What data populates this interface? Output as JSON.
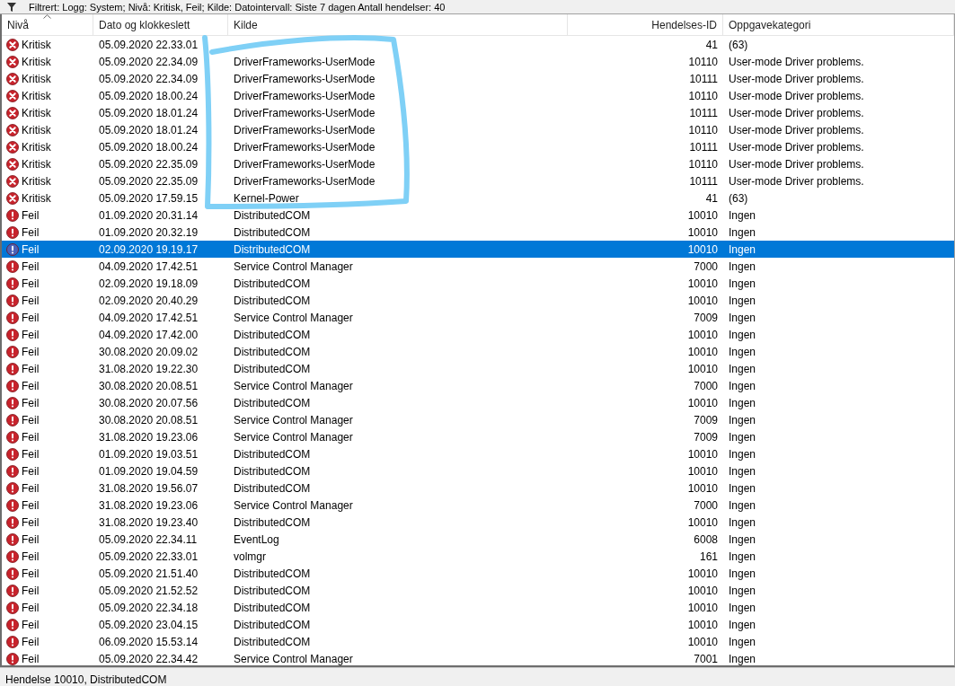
{
  "filter_bar": {
    "text": "Filtrert: Logg: System; Nivå: Kritisk, Feil; Kilde: Datointervall: Siste 7 dagen Antall hendelser: 40"
  },
  "table": {
    "columns": [
      "Nivå",
      "Dato og klokkeslett",
      "Kilde",
      "Hendelses-ID",
      "Oppgavekategori"
    ],
    "rows": [
      {
        "kind": "critical",
        "level": "Kritisk",
        "date": "05.09.2020 22.33.01",
        "id": "41",
        "category": "(63)",
        "selected": false
      },
      {
        "kind": "critical",
        "level": "Kritisk",
        "date": "05.09.2020 22.34.09",
        "source": "DriverFrameworks-UserMode",
        "id": "10110",
        "category": "User-mode Driver problems.",
        "selected": false
      },
      {
        "kind": "critical",
        "level": "Kritisk",
        "date": "05.09.2020 22.34.09",
        "source": "DriverFrameworks-UserMode",
        "id": "10111",
        "category": "User-mode Driver problems.",
        "selected": false
      },
      {
        "kind": "critical",
        "level": "Kritisk",
        "date": "05.09.2020 18.00.24",
        "source": "DriverFrameworks-UserMode",
        "id": "10110",
        "category": "User-mode Driver problems.",
        "selected": false
      },
      {
        "kind": "critical",
        "level": "Kritisk",
        "date": "05.09.2020 18.01.24",
        "source": "DriverFrameworks-UserMode",
        "id": "10111",
        "category": "User-mode Driver problems.",
        "selected": false
      },
      {
        "kind": "critical",
        "level": "Kritisk",
        "date": "05.09.2020 18.01.24",
        "source": "DriverFrameworks-UserMode",
        "id": "10110",
        "category": "User-mode Driver problems.",
        "selected": false
      },
      {
        "kind": "critical",
        "level": "Kritisk",
        "date": "05.09.2020 18.00.24",
        "source": "DriverFrameworks-UserMode",
        "id": "10111",
        "category": "User-mode Driver problems.",
        "selected": false
      },
      {
        "kind": "critical",
        "level": "Kritisk",
        "date": "05.09.2020 22.35.09",
        "source": "DriverFrameworks-UserMode",
        "id": "10110",
        "category": "User-mode Driver problems.",
        "selected": false
      },
      {
        "kind": "critical",
        "level": "Kritisk",
        "date": "05.09.2020 22.35.09",
        "source": "DriverFrameworks-UserMode",
        "id": "10111",
        "category": "User-mode Driver problems.",
        "selected": false
      },
      {
        "kind": "critical",
        "level": "Kritisk",
        "date": "05.09.2020 17.59.15",
        "source": "Kernel-Power",
        "id": "41",
        "category": "(63)",
        "selected": false
      },
      {
        "kind": "error",
        "level": "Feil",
        "date": "01.09.2020 20.31.14",
        "source": "DistributedCOM",
        "id": "10010",
        "category": "Ingen",
        "selected": false
      },
      {
        "kind": "error",
        "level": "Feil",
        "date": "01.09.2020 20.32.19",
        "source": "DistributedCOM",
        "id": "10010",
        "category": "Ingen",
        "selected": false
      },
      {
        "kind": "error",
        "level": "Feil",
        "date": "02.09.2020 19.19.17",
        "source": "DistributedCOM",
        "id": "10010",
        "category": "Ingen",
        "selected": true
      },
      {
        "kind": "error",
        "level": "Feil",
        "date": "04.09.2020 17.42.51",
        "source": "Service Control Manager",
        "id": "7000",
        "category": "Ingen",
        "selected": false
      },
      {
        "kind": "error",
        "level": "Feil",
        "date": "02.09.2020 19.18.09",
        "source": "DistributedCOM",
        "id": "10010",
        "category": "Ingen",
        "selected": false
      },
      {
        "kind": "error",
        "level": "Feil",
        "date": "02.09.2020 20.40.29",
        "source": "DistributedCOM",
        "id": "10010",
        "category": "Ingen",
        "selected": false
      },
      {
        "kind": "error",
        "level": "Feil",
        "date": "04.09.2020 17.42.51",
        "source": "Service Control Manager",
        "id": "7009",
        "category": "Ingen",
        "selected": false
      },
      {
        "kind": "error",
        "level": "Feil",
        "date": "04.09.2020 17.42.00",
        "source": "DistributedCOM",
        "id": "10010",
        "category": "Ingen",
        "selected": false
      },
      {
        "kind": "error",
        "level": "Feil",
        "date": "30.08.2020 20.09.02",
        "source": "DistributedCOM",
        "id": "10010",
        "category": "Ingen",
        "selected": false
      },
      {
        "kind": "error",
        "level": "Feil",
        "date": "31.08.2020 19.22.30",
        "source": "DistributedCOM",
        "id": "10010",
        "category": "Ingen",
        "selected": false
      },
      {
        "kind": "error",
        "level": "Feil",
        "date": "30.08.2020 20.08.51",
        "source": "Service Control Manager",
        "id": "7000",
        "category": "Ingen",
        "selected": false
      },
      {
        "kind": "error",
        "level": "Feil",
        "date": "30.08.2020 20.07.56",
        "source": "DistributedCOM",
        "id": "10010",
        "category": "Ingen",
        "selected": false
      },
      {
        "kind": "error",
        "level": "Feil",
        "date": "30.08.2020 20.08.51",
        "source": "Service Control Manager",
        "id": "7009",
        "category": "Ingen",
        "selected": false
      },
      {
        "kind": "error",
        "level": "Feil",
        "date": "31.08.2020 19.23.06",
        "source": "Service Control Manager",
        "id": "7009",
        "category": "Ingen",
        "selected": false
      },
      {
        "kind": "error",
        "level": "Feil",
        "date": "01.09.2020 19.03.51",
        "source": "DistributedCOM",
        "id": "10010",
        "category": "Ingen",
        "selected": false
      },
      {
        "kind": "error",
        "level": "Feil",
        "date": "01.09.2020 19.04.59",
        "source": "DistributedCOM",
        "id": "10010",
        "category": "Ingen",
        "selected": false
      },
      {
        "kind": "error",
        "level": "Feil",
        "date": "31.08.2020 19.56.07",
        "source": "DistributedCOM",
        "id": "10010",
        "category": "Ingen",
        "selected": false
      },
      {
        "kind": "error",
        "level": "Feil",
        "date": "31.08.2020 19.23.06",
        "source": "Service Control Manager",
        "id": "7000",
        "category": "Ingen",
        "selected": false
      },
      {
        "kind": "error",
        "level": "Feil",
        "date": "31.08.2020 19.23.40",
        "source": "DistributedCOM",
        "id": "10010",
        "category": "Ingen",
        "selected": false
      },
      {
        "kind": "error",
        "level": "Feil",
        "date": "05.09.2020 22.34.11",
        "source": "EventLog",
        "id": "6008",
        "category": "Ingen",
        "selected": false
      },
      {
        "kind": "error",
        "level": "Feil",
        "date": "05.09.2020 22.33.01",
        "source": "volmgr",
        "id": "161",
        "category": "Ingen",
        "selected": false
      },
      {
        "kind": "error",
        "level": "Feil",
        "date": "05.09.2020 21.51.40",
        "source": "DistributedCOM",
        "id": "10010",
        "category": "Ingen",
        "selected": false
      },
      {
        "kind": "error",
        "level": "Feil",
        "date": "05.09.2020 21.52.52",
        "source": "DistributedCOM",
        "id": "10010",
        "category": "Ingen",
        "selected": false
      },
      {
        "kind": "error",
        "level": "Feil",
        "date": "05.09.2020 22.34.18",
        "source": "DistributedCOM",
        "id": "10010",
        "category": "Ingen",
        "selected": false
      },
      {
        "kind": "error",
        "level": "Feil",
        "date": "05.09.2020 23.04.15",
        "source": "DistributedCOM",
        "id": "10010",
        "category": "Ingen",
        "selected": false
      },
      {
        "kind": "error",
        "level": "Feil",
        "date": "06.09.2020 15.53.14",
        "source": "DistributedCOM",
        "id": "10010",
        "category": "Ingen",
        "selected": false
      },
      {
        "kind": "error",
        "level": "Feil",
        "date": "05.09.2020 22.34.42",
        "source": "Service Control Manager",
        "id": "7001",
        "category": "Ingen",
        "selected": false
      }
    ]
  },
  "status_bar": {
    "text": "Hendelse 10010, DistributedCOM"
  }
}
